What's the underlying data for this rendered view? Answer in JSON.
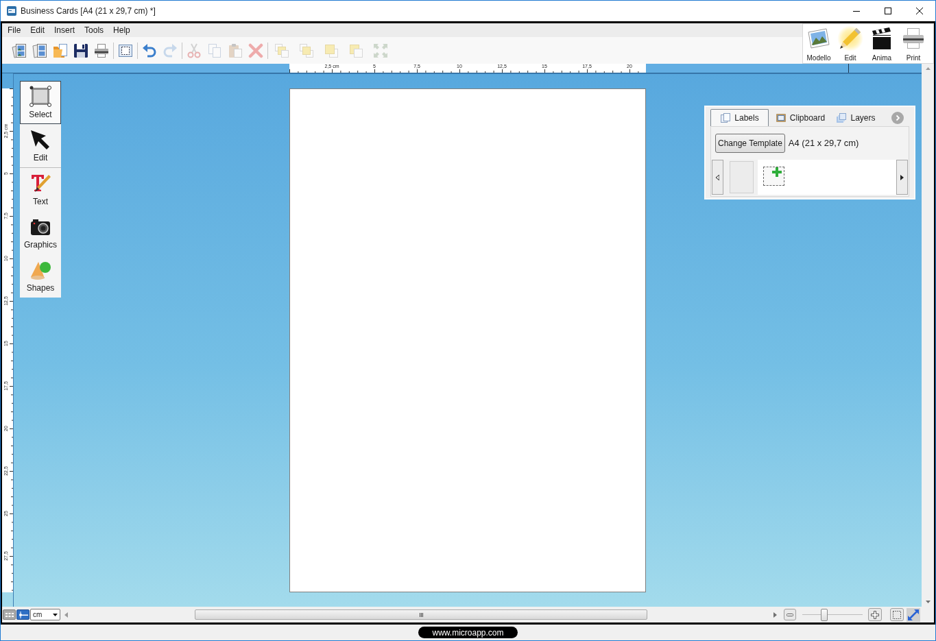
{
  "window": {
    "title": "Business Cards [A4 (21 x 29,7 cm) *]"
  },
  "menu": [
    "File",
    "Edit",
    "Insert",
    "Tools",
    "Help"
  ],
  "toolbar": [
    [
      {
        "disabled": false
      },
      {
        "disabled": false
      },
      {
        "disabled": false
      },
      {
        "disabled": false
      },
      {
        "disabled": false
      }
    ],
    [
      {
        "disabled": false
      }
    ],
    [
      {
        "disabled": false
      },
      {
        "disabled": true
      }
    ],
    [
      {
        "disabled": true
      },
      {
        "disabled": true
      },
      {
        "disabled": true
      },
      {
        "disabled": true
      }
    ],
    [
      {
        "disabled": true
      },
      {
        "disabled": true
      },
      {
        "disabled": true
      },
      {
        "disabled": true
      },
      {
        "disabled": true
      }
    ]
  ],
  "modes": [
    {
      "label": "Modello",
      "selected": false
    },
    {
      "label": "Edit",
      "selected": true
    },
    {
      "label": "Anima",
      "selected": false
    },
    {
      "label": "Print",
      "selected": false
    }
  ],
  "rulers": {
    "horizontal": [
      "2,5 cm",
      "5",
      "7,5",
      "10",
      "12,5",
      "15",
      "17,5",
      "20"
    ],
    "vertical": [
      "2,5 cm",
      "5",
      "7,5",
      "10",
      "12,5",
      "15",
      "17,5",
      "20",
      "22,5",
      "25",
      "27,5"
    ]
  },
  "tools": [
    [
      {
        "label": "Select",
        "selected": true
      },
      {
        "label": "Edit",
        "selected": false
      }
    ],
    [
      {
        "label": "Text",
        "selected": false
      },
      {
        "label": "Graphics",
        "selected": false
      },
      {
        "label": "Shapes",
        "selected": false
      }
    ]
  ],
  "panel": {
    "tabs": [
      {
        "label": "Labels",
        "selected": true
      },
      {
        "label": "Clipboard",
        "selected": false
      },
      {
        "label": "Layers",
        "selected": false
      }
    ],
    "template_button": "Change Template",
    "template_name": "A4 (21 x 29,7 cm)"
  },
  "status_bar": {
    "view_toggles": [
      {
        "selected": false
      },
      {
        "selected": true
      }
    ],
    "unit": "cm",
    "zoom": {
      "level": 0.35
    }
  },
  "footer": {
    "link": "www.microapp.com"
  }
}
